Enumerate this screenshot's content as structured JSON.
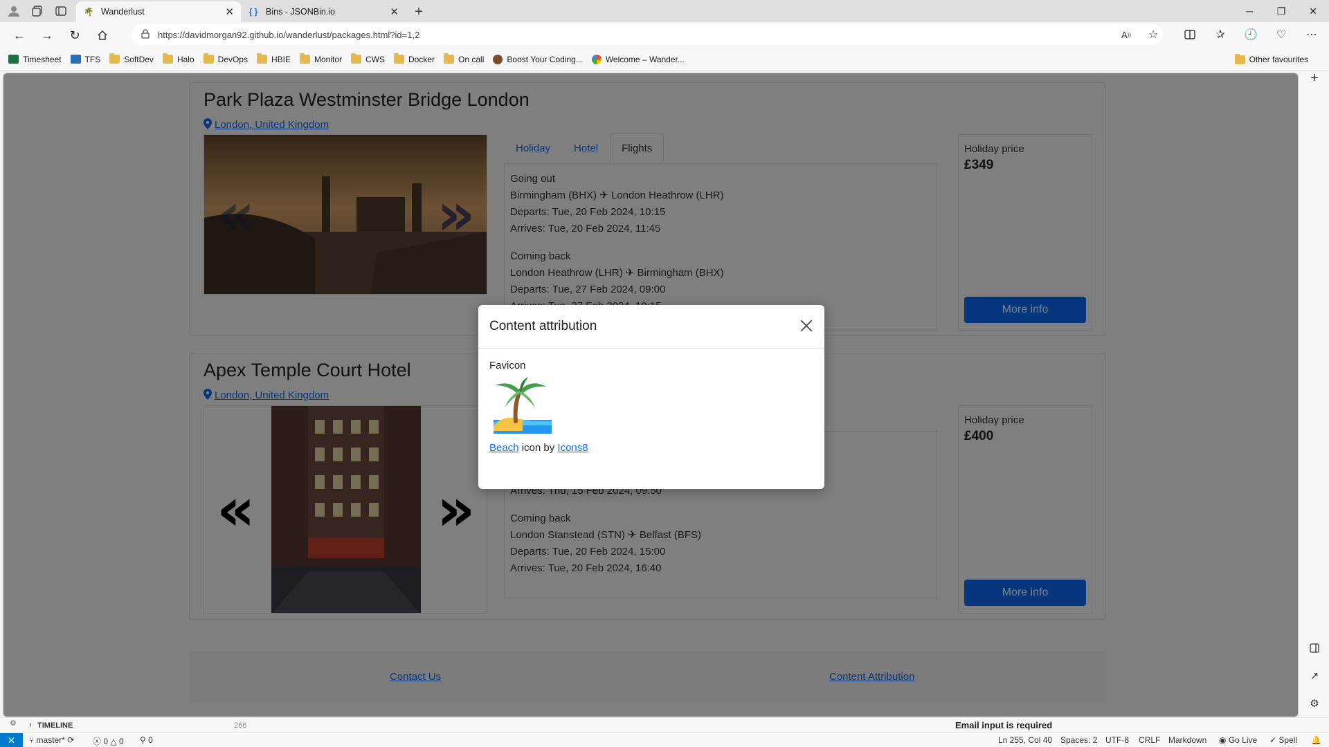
{
  "browser": {
    "tabs": [
      {
        "title": "Wanderlust",
        "active": true
      },
      {
        "title": "Bins - JSONBin.io",
        "active": false
      }
    ],
    "url": "https://davidmorgan92.github.io/wanderlust/packages.html?id=1,2",
    "bookmarks": [
      "Timesheet",
      "TFS",
      "SoftDev",
      "Halo",
      "DevOps",
      "HBIE",
      "Monitor",
      "CWS",
      "Docker",
      "On call",
      "Boost Your Coding...",
      "Welcome – Wander..."
    ],
    "other_favourites": "Other favourites"
  },
  "packages": [
    {
      "hotel": "Park Plaza Westminster Bridge London",
      "location": "London, United Kingdom",
      "tabs": [
        "Holiday",
        "Hotel",
        "Flights"
      ],
      "active_tab": "Flights",
      "flights": {
        "out_label": "Going out",
        "out_route_from": "Birmingham (BHX)",
        "out_route_to": "London Heathrow (LHR)",
        "out_depart": "Departs: Tue, 20 Feb 2024, 10:15",
        "out_arrive": "Arrives: Tue, 20 Feb 2024, 11:45",
        "back_label": "Coming back",
        "back_route_from": "London Heathrow (LHR)",
        "back_route_to": "Birmingham (BHX)",
        "back_depart": "Departs: Tue, 27 Feb 2024, 09:00",
        "back_arrive": "Arrives: Tue, 27 Feb 2024, 10:15"
      },
      "price_label": "Holiday price",
      "price": "£349",
      "more_info": "More info"
    },
    {
      "hotel": "Apex Temple Court Hotel",
      "location": "London, United Kingdom",
      "flights": {
        "out_arrive": "Arrives: Thu, 15 Feb 2024, 09:50",
        "back_label": "Coming back",
        "back_route_from": "London Stanstead (STN)",
        "back_route_to": "Belfast (BFS)",
        "back_depart": "Departs: Tue, 20 Feb 2024, 15:00",
        "back_arrive": "Arrives: Tue, 20 Feb 2024, 16:40"
      },
      "price_label": "Holiday price",
      "price": "£400",
      "more_info": "More info"
    }
  ],
  "footer": {
    "contact": "Contact Us",
    "attribution": "Content Attribution"
  },
  "modal": {
    "title": "Content attribution",
    "section": "Favicon",
    "link1": "Beach",
    "mid_text": " icon by ",
    "link2": "Icons8"
  },
  "vscode": {
    "timeline": "TIMELINE",
    "line_number": "268",
    "message": "Email input is required",
    "branch": "master*",
    "errors": "0",
    "warnings": "0",
    "ports": "0",
    "position": "Ln 255, Col 40",
    "spaces": "Spaces: 2",
    "encoding": "UTF-8",
    "eol": "CRLF",
    "language": "Markdown",
    "golive": "Go Live",
    "spell": "Spell"
  },
  "colors": {
    "accent": "#0d6efd",
    "status_remote": "#007acc"
  }
}
